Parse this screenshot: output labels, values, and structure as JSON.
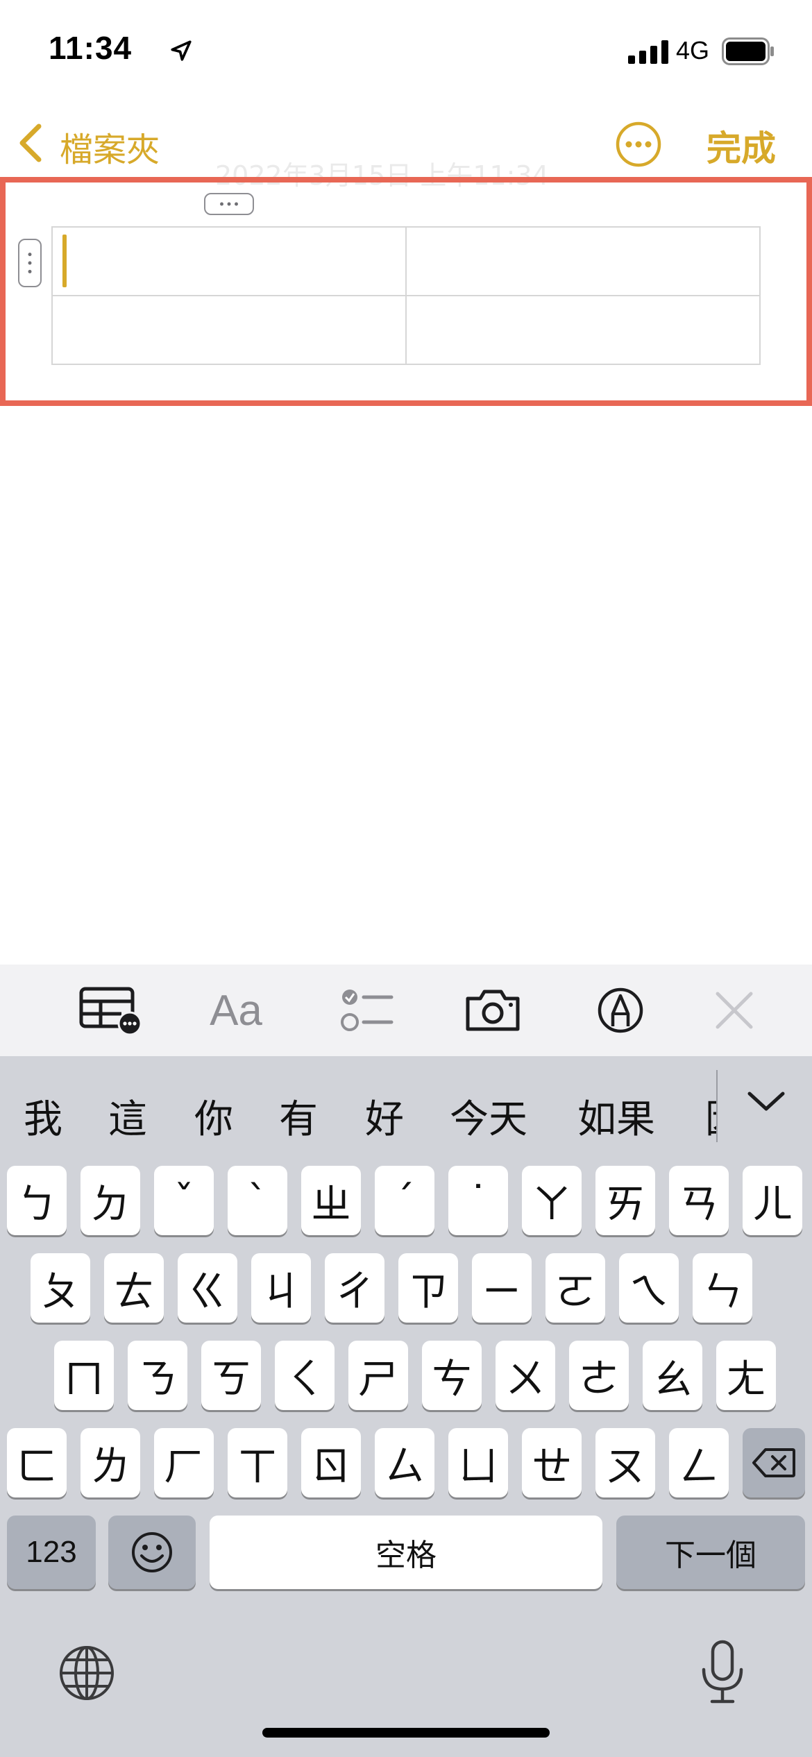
{
  "status": {
    "time": "11:34",
    "network": "4G"
  },
  "nav": {
    "back_label": "檔案夾",
    "done_label": "完成"
  },
  "note": {
    "date_text": "2022年3月15日 上午11:34"
  },
  "toolbar": {
    "items": [
      "table-icon",
      "text-format-icon",
      "checklist-icon",
      "camera-icon",
      "markup-pen-icon",
      "close-icon"
    ],
    "format_label": "Aa"
  },
  "keyboard": {
    "candidates": [
      "我",
      "這",
      "你",
      "有",
      "好",
      "今天",
      "如果",
      "因"
    ],
    "row1": [
      "ㄅ",
      "ㄉ",
      "ˇ",
      "ˋ",
      "ㄓ",
      "ˊ",
      "˙",
      "ㄚ",
      "ㄞ",
      "ㄢ",
      "ㄦ"
    ],
    "row2": [
      "ㄆ",
      "ㄊ",
      "ㄍ",
      "ㄐ",
      "ㄔ",
      "ㄗ",
      "ㄧ",
      "ㄛ",
      "ㄟ",
      "ㄣ"
    ],
    "row3": [
      "ㄇ",
      "ㄋ",
      "ㄎ",
      "ㄑ",
      "ㄕ",
      "ㄘ",
      "ㄨ",
      "ㄜ",
      "ㄠ",
      "ㄤ"
    ],
    "row4": [
      "ㄈ",
      "ㄌ",
      "ㄏ",
      "ㄒ",
      "ㄖ",
      "ㄙ",
      "ㄩ",
      "ㄝ",
      "ㄡ",
      "ㄥ"
    ],
    "numbers_label": "123",
    "space_label": "空格",
    "next_label": "下一個"
  },
  "colors": {
    "accent": "#D7A92A",
    "highlight": "#E86755",
    "keyboard_bg": "#d1d3d9"
  }
}
